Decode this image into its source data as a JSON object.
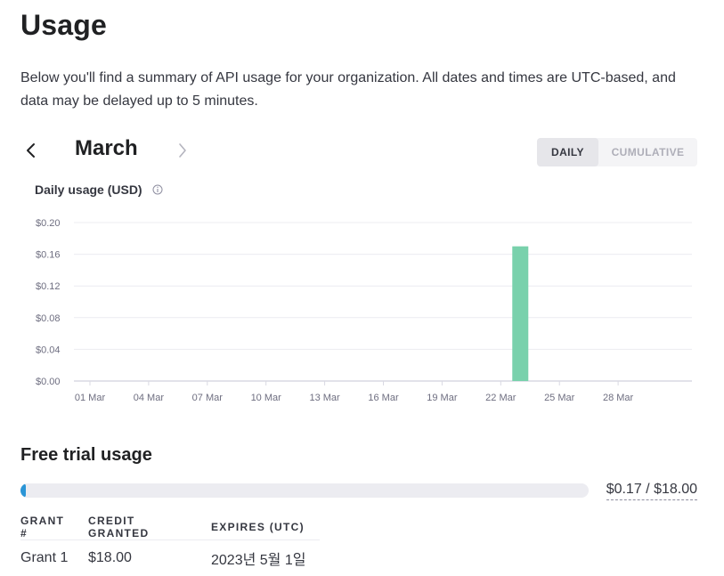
{
  "page": {
    "title": "Usage",
    "intro": "Below you'll find a summary of API usage for your organization. All dates and times are UTC-based, and data may be delayed up to 5 minutes."
  },
  "month_nav": {
    "month": "March",
    "prev_icon": "chevron-left-icon",
    "next_icon": "chevron-right-icon"
  },
  "view_toggle": {
    "options": [
      "DAILY",
      "CUMULATIVE"
    ],
    "selected": "DAILY"
  },
  "chart_title": "Daily usage (USD)",
  "info_icon": "info-icon",
  "colors": {
    "bar": "#79d1ac",
    "progress": "#2b95d6",
    "track": "#ececf1"
  },
  "chart_data": {
    "type": "bar",
    "title": "Daily usage (USD)",
    "x": [
      "01 Mar",
      "02 Mar",
      "03 Mar",
      "04 Mar",
      "05 Mar",
      "06 Mar",
      "07 Mar",
      "08 Mar",
      "09 Mar",
      "10 Mar",
      "11 Mar",
      "12 Mar",
      "13 Mar",
      "14 Mar",
      "15 Mar",
      "16 Mar",
      "17 Mar",
      "18 Mar",
      "19 Mar",
      "20 Mar",
      "21 Mar",
      "22 Mar",
      "23 Mar",
      "24 Mar",
      "25 Mar",
      "26 Mar",
      "27 Mar",
      "28 Mar",
      "29 Mar",
      "30 Mar",
      "31 Mar"
    ],
    "values": [
      0,
      0,
      0,
      0,
      0,
      0,
      0,
      0,
      0,
      0,
      0,
      0,
      0,
      0,
      0,
      0,
      0,
      0,
      0,
      0,
      0,
      0,
      0.17,
      0,
      0,
      0,
      0,
      0,
      0,
      0,
      0
    ],
    "x_tick_labels": [
      "01 Mar",
      "04 Mar",
      "07 Mar",
      "10 Mar",
      "13 Mar",
      "16 Mar",
      "19 Mar",
      "22 Mar",
      "25 Mar",
      "28 Mar"
    ],
    "y_tick_labels": [
      "$0.00",
      "$0.04",
      "$0.08",
      "$0.12",
      "$0.16",
      "$0.20"
    ],
    "y_ticks": [
      0,
      0.04,
      0.08,
      0.12,
      0.16,
      0.2
    ],
    "ylim": [
      0,
      0.2
    ],
    "grid": true
  },
  "free_trial": {
    "title": "Free trial usage",
    "used": 0.17,
    "total": 18.0,
    "label": "$0.17 / $18.00"
  },
  "grants": {
    "headers": [
      "GRANT #",
      "CREDIT GRANTED",
      "EXPIRES (UTC)"
    ],
    "rows": [
      [
        "Grant 1",
        "$18.00",
        "2023년 5월 1일"
      ]
    ]
  }
}
